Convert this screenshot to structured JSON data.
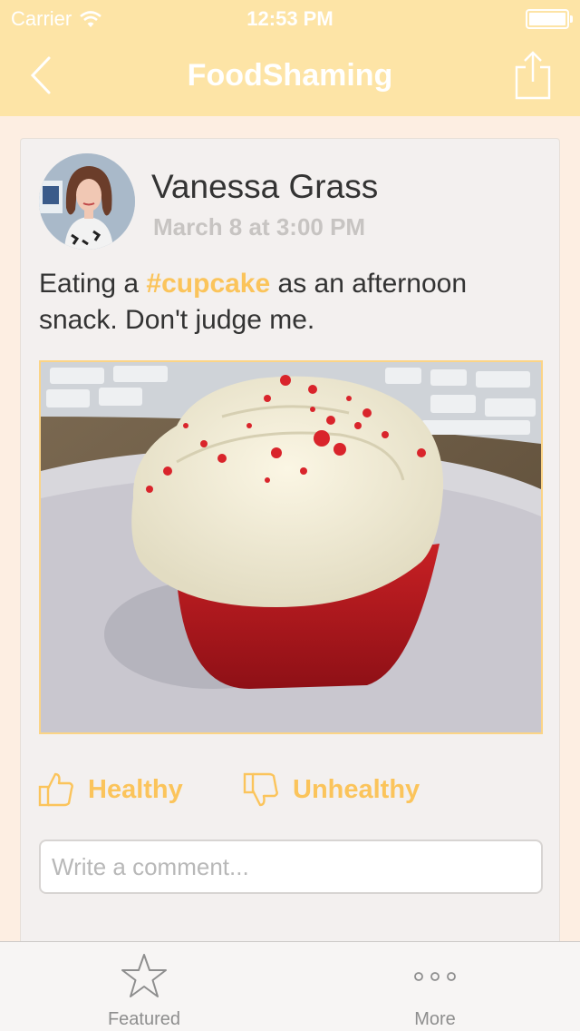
{
  "status_bar": {
    "carrier": "Carrier",
    "time": "12:53 PM"
  },
  "nav": {
    "title": "FoodShaming",
    "back_icon": "chevron-left-icon",
    "share_icon": "share-icon"
  },
  "post": {
    "author": "Vanessa Grass",
    "date": "March 8 at 3:00 PM",
    "text_before": "Eating a ",
    "hashtag": "#cupcake",
    "text_after": " as an afternoon snack. Don't judge me.",
    "photo_subject": "red velvet cupcake"
  },
  "votes": {
    "healthy_label": "Healthy",
    "unhealthy_label": "Unhealthy"
  },
  "comment": {
    "placeholder": "Write a comment..."
  },
  "tabs": [
    {
      "label": "Featured",
      "icon": "star-icon"
    },
    {
      "label": "More",
      "icon": "more-icon"
    }
  ],
  "colors": {
    "nav_bg": "#fde4a6",
    "accent": "#fbc45b",
    "background": "#fdeee2"
  }
}
